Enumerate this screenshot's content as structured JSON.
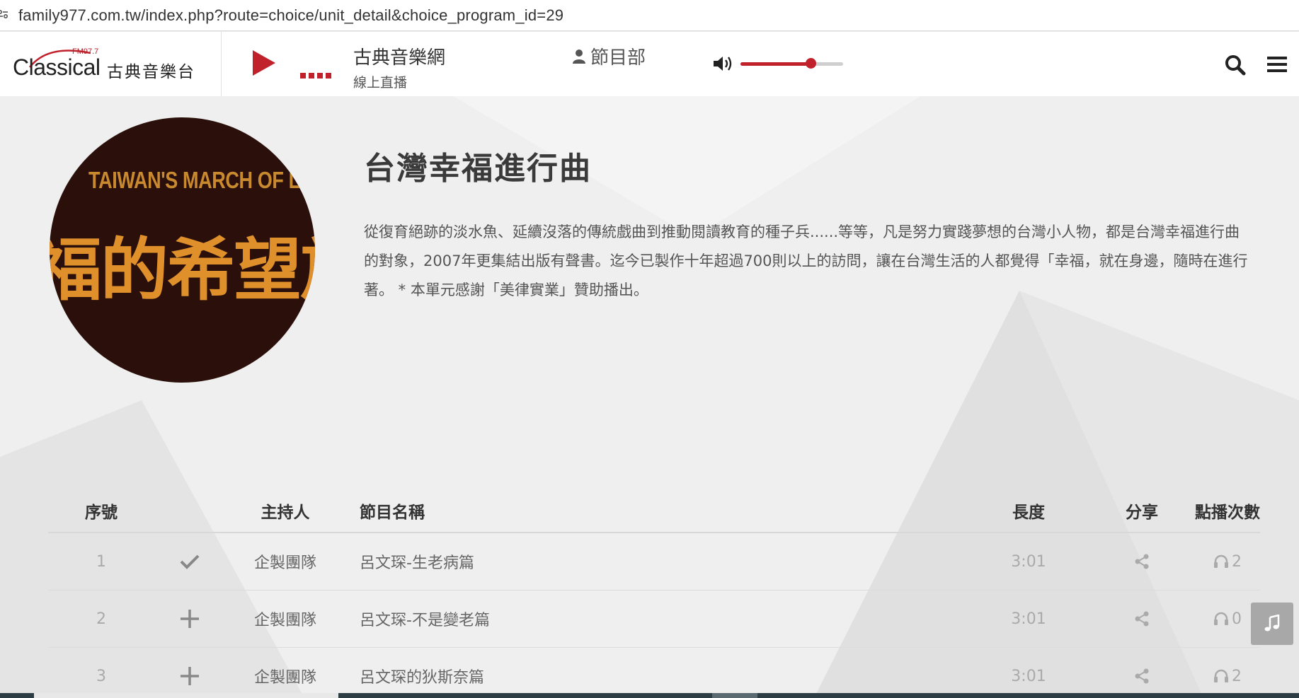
{
  "browser": {
    "url": "family977.com.tw/index.php?route=choice/unit_detail&choice_program_id=29"
  },
  "header": {
    "logo_text": "Classical",
    "logo_fm": "FM97.7",
    "logo_zh": "古典音樂台",
    "station_name": "古典音樂網",
    "station_sub": "線上直播",
    "department": "節目部",
    "volume_level": 0.68,
    "accent_color": "#c0212b"
  },
  "program": {
    "cover_text_en": "TAIWAN'S MARCH OF L",
    "cover_text_zh": "福的希望旅",
    "title": "台灣幸福進行曲",
    "description": "從復育絕跡的淡水魚、延續沒落的傳統戲曲到推動閱讀教育的種子兵......等等，凡是努力實踐夢想的台灣小人物，都是台灣幸福進行曲的對象，2007年更集結出版有聲書。迄今已製作十年超過700則以上的訪問，讓在台灣生活的人都覺得「幸福，就在身邊，隨時在進行著。 * 本單元感謝「美律實業」贊助播出。"
  },
  "table": {
    "headers": {
      "no": "序號",
      "host": "主持人",
      "name": "節目名稱",
      "length": "長度",
      "share": "分享",
      "plays": "點播次數"
    },
    "rows": [
      {
        "no": "1",
        "state": "check",
        "host": "企製團隊",
        "name": "呂文琛-生老病篇",
        "length": "3:01",
        "plays": "2"
      },
      {
        "no": "2",
        "state": "plus",
        "host": "企製團隊",
        "name": "呂文琛-不是變老篇",
        "length": "3:01",
        "plays": "0"
      },
      {
        "no": "3",
        "state": "plus",
        "host": "企製團隊",
        "name": "呂文琛的狄斯奈篇",
        "length": "3:01",
        "plays": "2"
      }
    ]
  }
}
